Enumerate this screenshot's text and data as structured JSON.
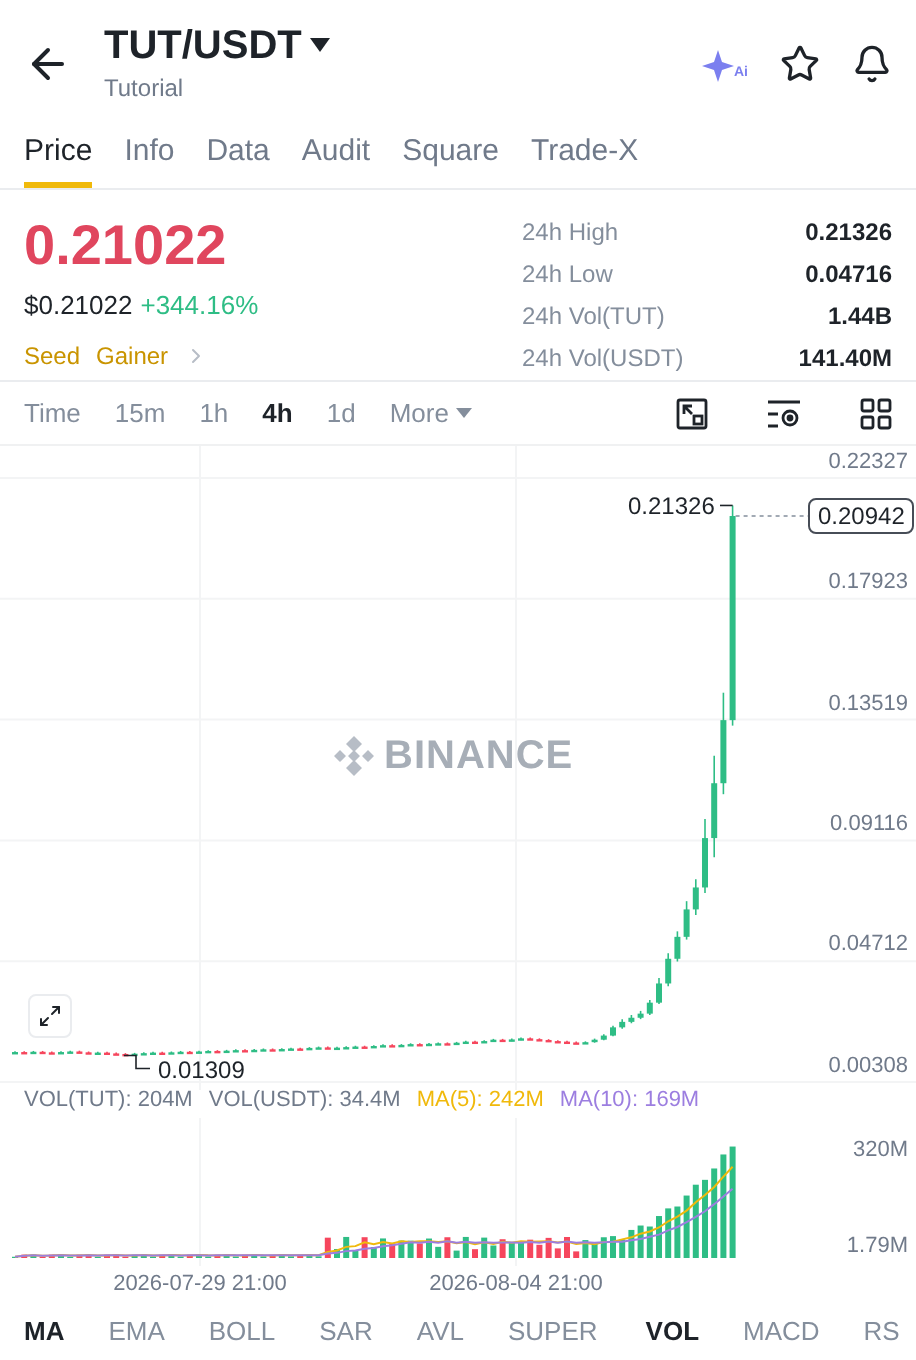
{
  "header": {
    "title": "TUT/USDT",
    "subtitle": "Tutorial",
    "ai_label": "Ai"
  },
  "tabs": [
    {
      "label": "Price",
      "selected": true
    },
    {
      "label": "Info",
      "selected": false
    },
    {
      "label": "Data",
      "selected": false
    },
    {
      "label": "Audit",
      "selected": false
    },
    {
      "label": "Square",
      "selected": false
    },
    {
      "label": "Trade-X",
      "selected": false
    }
  ],
  "price": {
    "last": "0.21022",
    "usd": "$0.21022",
    "change": "+344.16%",
    "tags": [
      "Seed",
      "Gainer"
    ]
  },
  "stats": [
    {
      "label": "24h High",
      "value": "0.21326"
    },
    {
      "label": "24h Low",
      "value": "0.04716"
    },
    {
      "label": "24h Vol(TUT)",
      "value": "1.44B"
    },
    {
      "label": "24h Vol(USDT)",
      "value": "141.40M"
    }
  ],
  "intervals": [
    {
      "label": "Time",
      "selected": false
    },
    {
      "label": "15m",
      "selected": false
    },
    {
      "label": "1h",
      "selected": false
    },
    {
      "label": "4h",
      "selected": true
    },
    {
      "label": "1d",
      "selected": false
    }
  ],
  "more": "More",
  "chart": {
    "watermark": "BINANCE",
    "high_label": "0.21326",
    "current_price": "0.20942",
    "low_label": "0.01309",
    "chart_data": {
      "type": "candlestick",
      "yticks": [
        0.22327,
        0.17923,
        0.13519,
        0.09116,
        0.04712,
        0.00308
      ],
      "ylim": [
        0.00308,
        0.22327
      ],
      "grid": true,
      "ohlc": [
        [
          0.0139,
          0.0143,
          0.0136,
          0.014
        ],
        [
          0.014,
          0.0143,
          0.0135,
          0.0138
        ],
        [
          0.0138,
          0.0144,
          0.0135,
          0.0141
        ],
        [
          0.0141,
          0.0144,
          0.0136,
          0.0139
        ],
        [
          0.0139,
          0.0142,
          0.0134,
          0.0137
        ],
        [
          0.0137,
          0.0143,
          0.0134,
          0.014
        ],
        [
          0.014,
          0.0145,
          0.0137,
          0.0142
        ],
        [
          0.0142,
          0.0145,
          0.0136,
          0.0139
        ],
        [
          0.0139,
          0.0142,
          0.0133,
          0.0136
        ],
        [
          0.0136,
          0.0141,
          0.0133,
          0.0138
        ],
        [
          0.0138,
          0.0141,
          0.0132,
          0.0135
        ],
        [
          0.0135,
          0.0138,
          0.013,
          0.0133
        ],
        [
          0.0133,
          0.0136,
          0.01309,
          0.0131
        ],
        [
          0.0131,
          0.0137,
          0.0128,
          0.0134
        ],
        [
          0.0134,
          0.0139,
          0.0131,
          0.0136
        ],
        [
          0.0136,
          0.0141,
          0.0133,
          0.0138
        ],
        [
          0.0138,
          0.0141,
          0.0134,
          0.0137
        ],
        [
          0.0137,
          0.0142,
          0.0134,
          0.0139
        ],
        [
          0.0139,
          0.0144,
          0.0136,
          0.0141
        ],
        [
          0.0141,
          0.0144,
          0.0137,
          0.014
        ],
        [
          0.014,
          0.0145,
          0.0137,
          0.0142
        ],
        [
          0.0142,
          0.0147,
          0.0139,
          0.0144
        ],
        [
          0.0144,
          0.0147,
          0.014,
          0.0143
        ],
        [
          0.0143,
          0.0148,
          0.014,
          0.0145
        ],
        [
          0.0145,
          0.015,
          0.0142,
          0.0147
        ],
        [
          0.0147,
          0.015,
          0.0143,
          0.0146
        ],
        [
          0.0146,
          0.0151,
          0.0143,
          0.0148
        ],
        [
          0.0148,
          0.0153,
          0.0145,
          0.015
        ],
        [
          0.015,
          0.0153,
          0.0146,
          0.0149
        ],
        [
          0.0149,
          0.0154,
          0.0146,
          0.0151
        ],
        [
          0.0151,
          0.0156,
          0.0148,
          0.0153
        ],
        [
          0.0153,
          0.0156,
          0.0149,
          0.0152
        ],
        [
          0.0152,
          0.0158,
          0.0149,
          0.0155
        ],
        [
          0.0155,
          0.016,
          0.0152,
          0.0157
        ],
        [
          0.0157,
          0.016,
          0.0151,
          0.0154
        ],
        [
          0.0154,
          0.0159,
          0.0151,
          0.0156
        ],
        [
          0.0156,
          0.0161,
          0.0153,
          0.0158
        ],
        [
          0.0158,
          0.0163,
          0.0155,
          0.016
        ],
        [
          0.016,
          0.0163,
          0.0156,
          0.0159
        ],
        [
          0.0159,
          0.0165,
          0.0156,
          0.0162
        ],
        [
          0.0162,
          0.0168,
          0.0159,
          0.0165
        ],
        [
          0.0165,
          0.0168,
          0.016,
          0.0163
        ],
        [
          0.0163,
          0.0169,
          0.016,
          0.0166
        ],
        [
          0.0166,
          0.0172,
          0.0163,
          0.0169
        ],
        [
          0.0169,
          0.0172,
          0.0164,
          0.0167
        ],
        [
          0.0167,
          0.0173,
          0.0164,
          0.017
        ],
        [
          0.017,
          0.0175,
          0.0167,
          0.0172
        ],
        [
          0.0172,
          0.0175,
          0.0167,
          0.017
        ],
        [
          0.017,
          0.0177,
          0.0167,
          0.0174
        ],
        [
          0.0174,
          0.0181,
          0.0171,
          0.0178
        ],
        [
          0.0178,
          0.0181,
          0.0173,
          0.0176
        ],
        [
          0.0176,
          0.0183,
          0.0173,
          0.018
        ],
        [
          0.018,
          0.0188,
          0.0177,
          0.0185
        ],
        [
          0.0185,
          0.0188,
          0.0179,
          0.0182
        ],
        [
          0.0182,
          0.0189,
          0.0179,
          0.0186
        ],
        [
          0.0186,
          0.0193,
          0.0183,
          0.019
        ],
        [
          0.019,
          0.0193,
          0.0184,
          0.0187
        ],
        [
          0.0187,
          0.019,
          0.0181,
          0.0184
        ],
        [
          0.0184,
          0.0187,
          0.0177,
          0.018
        ],
        [
          0.018,
          0.0183,
          0.0175,
          0.0178
        ],
        [
          0.0178,
          0.0181,
          0.0172,
          0.0175
        ],
        [
          0.0175,
          0.0178,
          0.0169,
          0.0172
        ],
        [
          0.0172,
          0.0179,
          0.017,
          0.0176
        ],
        [
          0.0176,
          0.0189,
          0.0174,
          0.0185
        ],
        [
          0.0185,
          0.0205,
          0.0183,
          0.02
        ],
        [
          0.02,
          0.0236,
          0.0198,
          0.023
        ],
        [
          0.023,
          0.026,
          0.0225,
          0.025
        ],
        [
          0.025,
          0.0275,
          0.0245,
          0.0265
        ],
        [
          0.0265,
          0.029,
          0.026,
          0.028
        ],
        [
          0.028,
          0.033,
          0.0275,
          0.032
        ],
        [
          0.032,
          0.041,
          0.0315,
          0.039
        ],
        [
          0.039,
          0.05,
          0.038,
          0.048
        ],
        [
          0.048,
          0.058,
          0.047,
          0.056
        ],
        [
          0.056,
          0.069,
          0.055,
          0.066
        ],
        [
          0.066,
          0.077,
          0.064,
          0.074
        ],
        [
          0.074,
          0.099,
          0.072,
          0.092
        ],
        [
          0.092,
          0.122,
          0.085,
          0.112
        ],
        [
          0.112,
          0.145,
          0.108,
          0.135
        ],
        [
          0.135,
          0.21326,
          0.133,
          0.20942
        ]
      ]
    }
  },
  "volume": {
    "legend": [
      {
        "text": "VOL(TUT): 204M",
        "color": "#707a8a"
      },
      {
        "text": "VOL(USDT): 34.4M",
        "color": "#707a8a"
      },
      {
        "text": "MA(5): 242M",
        "color": "#f0b90b"
      },
      {
        "text": "MA(10): 169M",
        "color": "#9c7ee0"
      }
    ],
    "y_ticks": [
      "320M",
      "1.79M"
    ],
    "dates": [
      "2026-07-29 21:00",
      "2026-08-04 21:00"
    ]
  },
  "main_indicators": [
    {
      "label": "MA",
      "selected": true
    },
    {
      "label": "EMA",
      "selected": false
    },
    {
      "label": "BOLL",
      "selected": false
    },
    {
      "label": "SAR",
      "selected": false
    },
    {
      "label": "AVL",
      "selected": false
    },
    {
      "label": "SUPER",
      "selected": false
    }
  ],
  "sub_indicators": [
    {
      "label": "VOL",
      "selected": true
    },
    {
      "label": "MACD",
      "selected": false
    },
    {
      "label": "RS",
      "selected": false
    }
  ]
}
